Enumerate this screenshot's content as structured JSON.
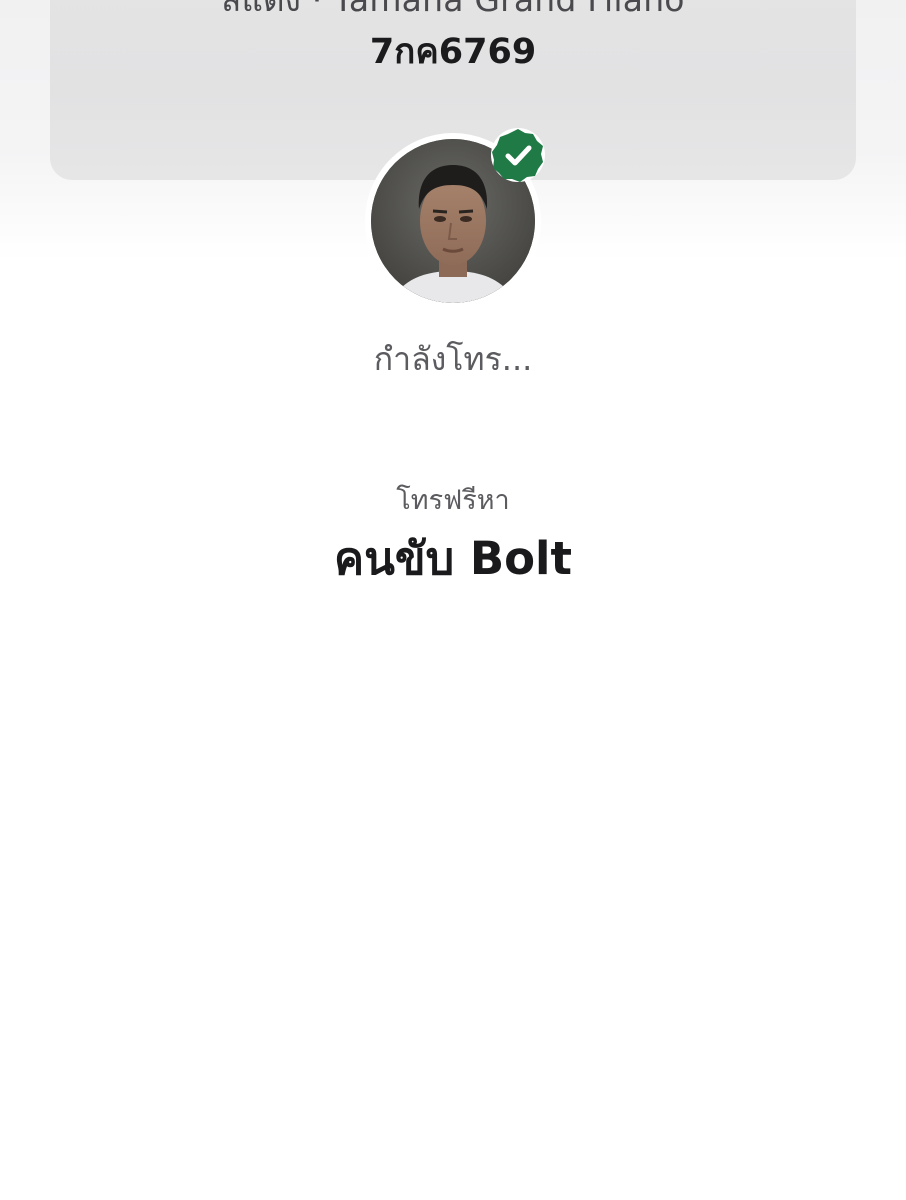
{
  "vehicle": {
    "description": "สีแดง · Yamaha Grand Filano",
    "plate": "7กค6769"
  },
  "driver": {
    "verified_icon": "verified-check-badge-icon",
    "avatar": "driver-photo"
  },
  "call": {
    "status": "กำลังโทร...",
    "free_call_label": "โทรฟรีหา",
    "callee": "คนขับ Bolt"
  },
  "colors": {
    "badge_green": "#1f7a45",
    "card_gray": "#e3e3e4",
    "text_dark": "#1a1a1c",
    "text_muted": "#5c5c60"
  }
}
